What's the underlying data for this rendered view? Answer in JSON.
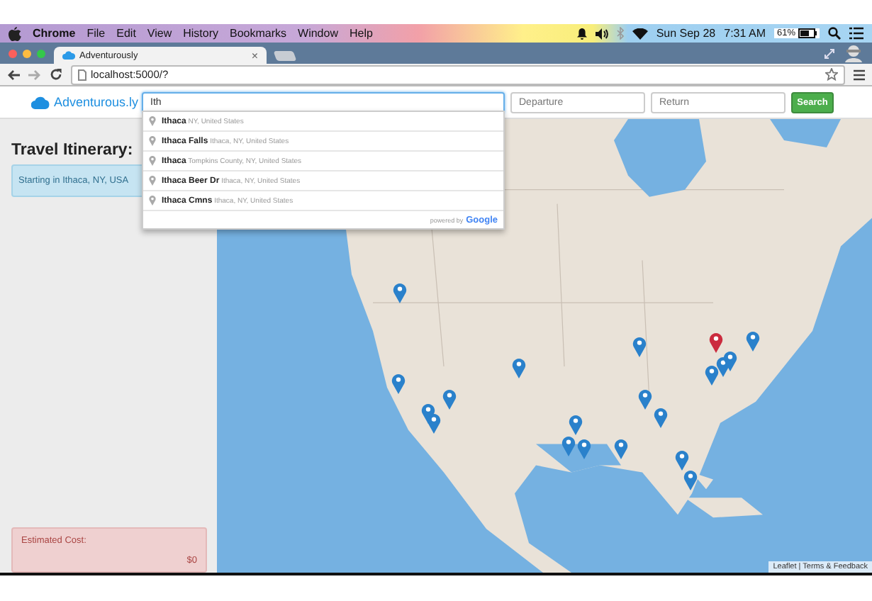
{
  "menu_bar": {
    "app": "Chrome",
    "items": [
      "File",
      "Edit",
      "View",
      "History",
      "Bookmarks",
      "Window",
      "Help"
    ],
    "date": "Sun Sep 28",
    "time": "7:31 AM",
    "battery": "61%"
  },
  "browser": {
    "tab": {
      "title": "Adventurously",
      "close": "×",
      "selected": true
    },
    "address": "localhost:5000/?"
  },
  "navbar": {
    "brand": "Adventurous.ly",
    "destination": {
      "value": "Ith"
    },
    "departure": {
      "placeholder": "Departure"
    },
    "return": {
      "placeholder": "Return"
    },
    "search_button": "Search"
  },
  "autocomplete": {
    "items": [
      {
        "main": "Ithaca",
        "secondary": "NY, United States"
      },
      {
        "main": "Ithaca Falls",
        "secondary": "Ithaca, NY, United States"
      },
      {
        "main": "Ithaca",
        "secondary": "Tompkins County, NY, United States"
      },
      {
        "main": "Ithaca Beer Dr",
        "secondary": "Ithaca, NY, United States"
      },
      {
        "main": "Ithaca Cmns",
        "secondary": "Ithaca, NY, United States"
      }
    ],
    "footer": "powered by",
    "provider": "Google"
  },
  "sidebar": {
    "title": "Travel Itinerary:",
    "start": "Starting in Ithaca, NY, USA",
    "cost_label": "Estimated Cost:",
    "cost_value": "$0"
  },
  "map": {
    "markers": [
      {
        "color": "#2a81cb"
      },
      {
        "color": "#2a81cb"
      },
      {
        "color": "#2a81cb"
      },
      {
        "color": "#2a81cb"
      },
      {
        "color": "#2a81cb"
      },
      {
        "color": "#2a81cb"
      },
      {
        "color": "#2a81cb"
      },
      {
        "color": "#2a81cb"
      },
      {
        "color": "#2a81cb"
      },
      {
        "color": "#2a81cb"
      },
      {
        "color": "#2a81cb"
      },
      {
        "color": "#2a81cb"
      },
      {
        "color": "#2a81cb"
      },
      {
        "color": "#2a81cb"
      },
      {
        "color": "#2a81cb"
      },
      {
        "color": "#2a81cb"
      },
      {
        "color": "#2a81cb"
      },
      {
        "color": "#2a81cb"
      },
      {
        "color": "#2a81cb"
      },
      {
        "color": "#cb2b3e"
      }
    ],
    "attribution": "Leaflet | Terms & Feedback"
  }
}
